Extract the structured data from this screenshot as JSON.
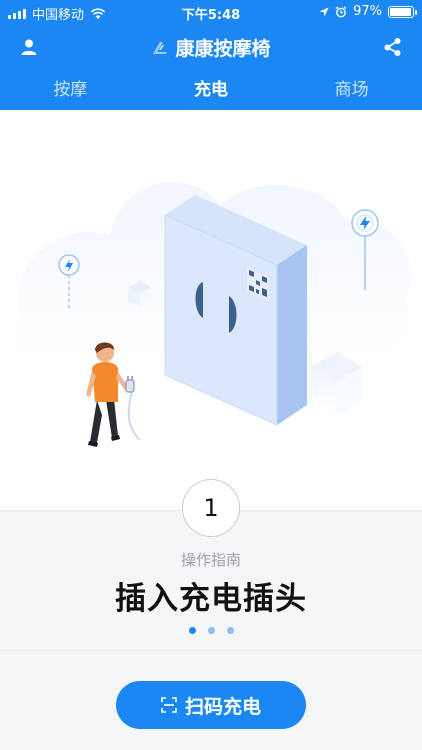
{
  "status_bar": {
    "carrier": "中国移动",
    "time": "下午5:48",
    "battery": "97%",
    "battery_level": 0.97,
    "icons": [
      "signal-icon",
      "wifi-icon",
      "location-icon",
      "alarm-icon",
      "battery-icon"
    ]
  },
  "navbar": {
    "title": "康康按摩椅",
    "icons": [
      "user-icon",
      "logo-icon",
      "share-icon"
    ]
  },
  "tabs": [
    {
      "label": "按摩",
      "active": false
    },
    {
      "label": "充电",
      "active": true
    },
    {
      "label": "商场",
      "active": false
    }
  ],
  "step": {
    "number": "1",
    "label": "操作指南",
    "title": "插入充电插头",
    "dots_total": 3,
    "dots_active": 0
  },
  "action": {
    "scan_label": "扫码充电",
    "icon": "scan-icon"
  },
  "colors": {
    "primary": "#1b87f3",
    "box": "#dbe7fb",
    "person_shirt": "#f28a2c"
  }
}
